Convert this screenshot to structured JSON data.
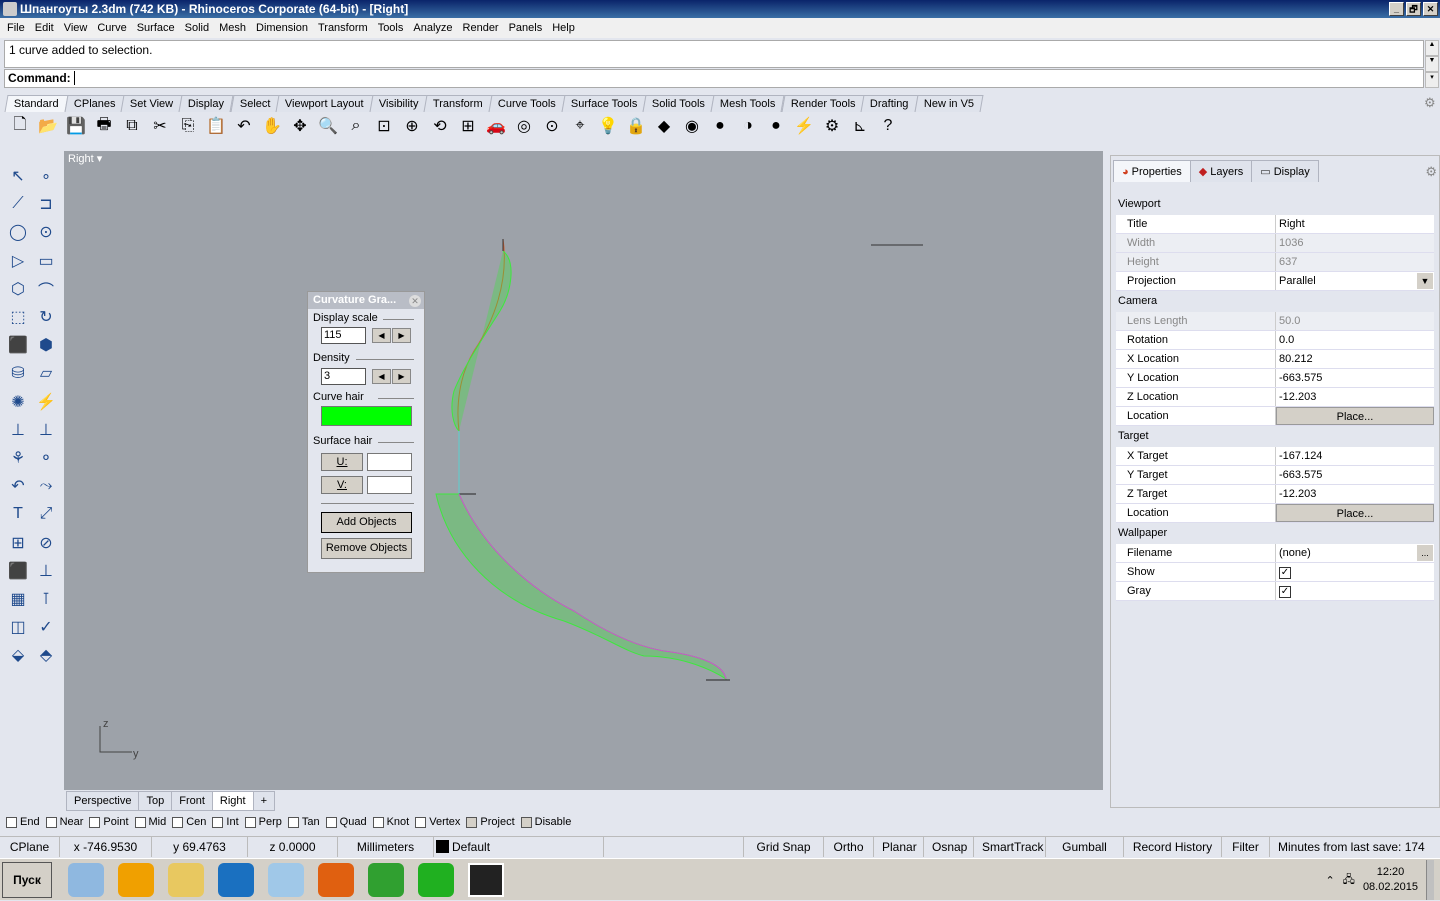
{
  "window": {
    "title": "Шпангоуты 2.3dm (742 KB) - Rhinoceros Corporate (64-bit) - [Right]",
    "controls": [
      "_",
      "🗗",
      "✕"
    ]
  },
  "menu": [
    "File",
    "Edit",
    "View",
    "Curve",
    "Surface",
    "Solid",
    "Mesh",
    "Dimension",
    "Transform",
    "Tools",
    "Analyze",
    "Render",
    "Panels",
    "Help"
  ],
  "command": {
    "history": "1 curve added to selection.",
    "prompt": "Command:"
  },
  "toolbar_tabs": [
    "Standard",
    "CPlanes",
    "Set View",
    "Display",
    "Select",
    "Viewport Layout",
    "Visibility",
    "Transform",
    "Curve Tools",
    "Surface Tools",
    "Solid Tools",
    "Mesh Tools",
    "Render Tools",
    "Drafting",
    "New in V5"
  ],
  "toolbar_icons": [
    "new-icon",
    "open-icon",
    "save-icon",
    "print-icon",
    "import-icon",
    "cut-icon",
    "copy-icon",
    "paste-icon",
    "undo-icon",
    "pan-icon",
    "move-view-icon",
    "zoom-icon",
    "zoom-window-icon",
    "zoom-extents-icon",
    "zoom-selected-icon",
    "rotate-view-icon",
    "four-viewports-icon",
    "car-icon",
    "render-mesh-icon",
    "cplane-icon",
    "snapshot-icon",
    "light-icon",
    "lock-icon",
    "layer-icon",
    "color-wheel-icon",
    "sphere-shade-icon",
    "sphere-render-icon",
    "sphere-blue-icon",
    "filter-icon",
    "options-icon",
    "dimension-icon",
    "help-icon"
  ],
  "toolbar_glyphs": [
    "🗋",
    "📂",
    "💾",
    "🖶",
    "⧉",
    "✂",
    "⎘",
    "📋",
    "↶",
    "✋",
    "✥",
    "🔍",
    "⌕",
    "⊡",
    "⊕",
    "⟲",
    "⊞",
    "🚗",
    "◎",
    "⊙",
    "⌖",
    "💡",
    "🔒",
    "◆",
    "◉",
    "●",
    "◑",
    "●",
    "⚡",
    "⚙",
    "⊾",
    "?"
  ],
  "left_tools": [
    "↖",
    "∘",
    "⟋",
    "⊐",
    "◯",
    "⊙",
    "▷",
    "▭",
    "⬡",
    "⌒",
    "⬚",
    "↻",
    "⬛",
    "⬢",
    "⛁",
    "▱",
    "✺",
    "⚡",
    "⊥",
    "⊥",
    "⚘",
    "⚬",
    "↶",
    "⤳",
    "T",
    "⤢",
    "⊞",
    "⊘",
    "⬛",
    "⊥",
    "▦",
    "⊺",
    "◫",
    "✓",
    "⬙",
    "⬘"
  ],
  "viewport": {
    "label": "Right",
    "axis_z": "z",
    "axis_y": "y",
    "background": "#9da2a9"
  },
  "viewport_tabs": [
    "Perspective",
    "Top",
    "Front",
    "Right",
    "+"
  ],
  "active_viewport": "Right",
  "osnaps": [
    {
      "label": "End",
      "checked": false
    },
    {
      "label": "Near",
      "checked": false
    },
    {
      "label": "Point",
      "checked": false
    },
    {
      "label": "Mid",
      "checked": false
    },
    {
      "label": "Cen",
      "checked": false
    },
    {
      "label": "Int",
      "checked": false
    },
    {
      "label": "Perp",
      "checked": false
    },
    {
      "label": "Tan",
      "checked": false
    },
    {
      "label": "Quad",
      "checked": false
    },
    {
      "label": "Knot",
      "checked": false
    },
    {
      "label": "Vertex",
      "checked": false
    },
    {
      "label": "Project",
      "checked": false
    },
    {
      "label": "Disable",
      "checked": false
    }
  ],
  "status": [
    "CPlane",
    "x -746.9530",
    "y 69.4763",
    "z 0.0000",
    "Millimeters",
    "Default",
    "",
    "Grid Snap",
    "Ortho",
    "Planar",
    "Osnap",
    "SmartTrack",
    "Gumball",
    "Record History",
    "Filter",
    "Minutes from last save: 174"
  ],
  "curvature_graph": {
    "title": "Curvature Gra...",
    "display_scale_label": "Display scale",
    "display_scale": "115",
    "density_label": "Density",
    "density": "3",
    "curve_hair_label": "Curve hair",
    "curve_hair_color": "#00ff00",
    "surface_hair_label": "Surface hair",
    "u_label": "U:",
    "v_label": "V:",
    "add_objects": "Add Objects",
    "remove_objects": "Remove Objects"
  },
  "panel": {
    "tabs": [
      "Properties",
      "Layers",
      "Display"
    ],
    "sections": [
      {
        "title": "Viewport",
        "rows": [
          {
            "k": "Title",
            "v": "Right"
          },
          {
            "k": "Width",
            "v": "1036",
            "disabled": true
          },
          {
            "k": "Height",
            "v": "637",
            "disabled": true
          },
          {
            "k": "Projection",
            "v": "Parallel",
            "dropdown": true
          }
        ]
      },
      {
        "title": "Camera",
        "rows": [
          {
            "k": "Lens Length",
            "v": "50.0",
            "disabled": true
          },
          {
            "k": "Rotation",
            "v": "0.0"
          },
          {
            "k": "X Location",
            "v": "80.212"
          },
          {
            "k": "Y Location",
            "v": "-663.575"
          },
          {
            "k": "Z Location",
            "v": "-12.203"
          },
          {
            "k": "Location",
            "v": "Place...",
            "button": true
          }
        ]
      },
      {
        "title": "Target",
        "rows": [
          {
            "k": "X Target",
            "v": "-167.124"
          },
          {
            "k": "Y Target",
            "v": "-663.575"
          },
          {
            "k": "Z Target",
            "v": "-12.203"
          },
          {
            "k": "Location",
            "v": "Place...",
            "button": true
          }
        ]
      },
      {
        "title": "Wallpaper",
        "rows": [
          {
            "k": "Filename",
            "v": "(none)",
            "browse": "..."
          },
          {
            "k": "Show",
            "v": "✓",
            "checkbox": true
          },
          {
            "k": "Gray",
            "v": "✓",
            "checkbox": true
          }
        ]
      }
    ]
  },
  "taskbar": {
    "start": "Пуск",
    "time": "12:20",
    "date": "08.02.2015",
    "apps": [
      "calculator-icon",
      "aimp-icon",
      "explorer-icon",
      "mail-agent-icon",
      "notepad-icon",
      "firefox-icon",
      "chrome-icon",
      "icq-icon",
      "rhino-icon"
    ],
    "app_colors": [
      "#8fb8e0",
      "#f0a000",
      "#e8c860",
      "#1a70c0",
      "#a0c8e8",
      "#e06010",
      "#30a030",
      "#20b020",
      "#222222"
    ]
  }
}
